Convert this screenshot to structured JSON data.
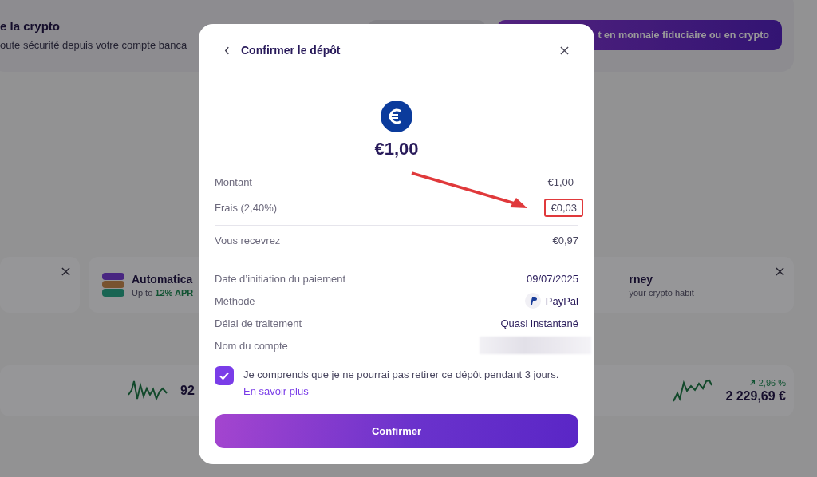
{
  "background": {
    "banner": {
      "title": "e la crypto",
      "subtitle": "oute sécurité depuis votre compte banca",
      "primary_button": "t en monnaie fiduciaire ou en crypto"
    },
    "promos": [
      {
        "closable": true
      },
      {
        "title": "Automatica",
        "subtitle_start": "Up to ",
        "subtitle_highlight": "12% APR",
        "closable": false
      },
      {
        "title": "rney",
        "subtitle": "your crypto habit",
        "closable": true
      }
    ],
    "assets": [
      {
        "value": "92"
      },
      {
        "value": "2 229,69 €",
        "change": "2,96 %"
      }
    ]
  },
  "dialog": {
    "title": "Confirmer le dépôt",
    "amount": "€1,00",
    "summary": [
      {
        "label": "Montant",
        "value": "€1,00",
        "highlighted": false
      },
      {
        "label": "Frais (2,40%)",
        "value": "€0,03",
        "highlighted": true
      }
    ],
    "total": {
      "label": "Vous recevrez",
      "value": "€0,97"
    },
    "details": [
      {
        "kind": "text",
        "label": "Date d’initiation du paiement",
        "value": "09/07/2025"
      },
      {
        "kind": "method",
        "label": "Méthode",
        "value": "PayPal"
      },
      {
        "kind": "text",
        "label": "Délai de traitement",
        "value": "Quasi instantané"
      },
      {
        "kind": "redacted",
        "label": "Nom du compte"
      }
    ],
    "consent": {
      "checked": true,
      "text": "Je comprends que je ne pourrai pas retirer ce dépôt pendant 3 jours.",
      "link": "En savoir plus"
    },
    "confirm_button": "Confirmer"
  }
}
